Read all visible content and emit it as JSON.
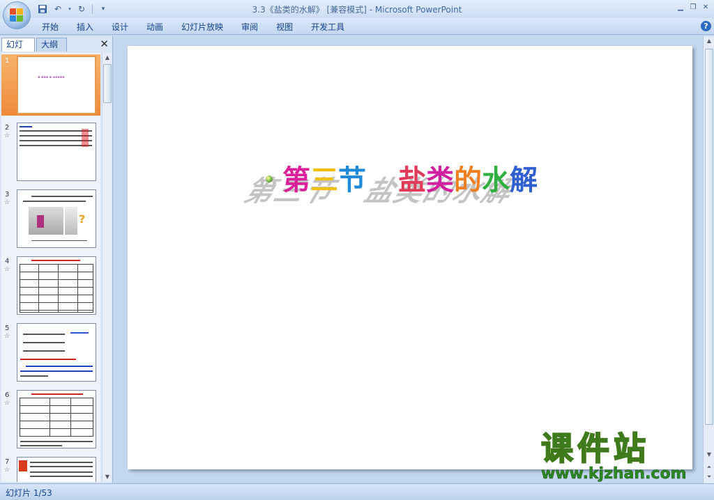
{
  "window": {
    "title_doc": "3.3《盐类的水解》 [兼容模式] -",
    "title_app": "Microsoft PowerPoint"
  },
  "ribbon": {
    "tabs": [
      "开始",
      "插入",
      "设计",
      "动画",
      "幻灯片放映",
      "审阅",
      "视图",
      "开发工具"
    ]
  },
  "panel": {
    "tab_slides": "幻灯片",
    "tab_outline": "大纲",
    "thumbnails": [
      {
        "num": "1",
        "selected": true
      },
      {
        "num": "2",
        "selected": false
      },
      {
        "num": "3",
        "selected": false
      },
      {
        "num": "4",
        "selected": false
      },
      {
        "num": "5",
        "selected": false
      },
      {
        "num": "6",
        "selected": false
      },
      {
        "num": "7",
        "selected": false
      }
    ]
  },
  "slide": {
    "title_part1": "第三节",
    "title_part2": "盐类的水解"
  },
  "status": {
    "slide_counter": "幻灯片 1/53"
  },
  "watermark": {
    "cn": "课件站",
    "url": "www.kjzhan.com"
  },
  "colors": {
    "selection": "#ee8a3b",
    "ribbon_text": "#15428b",
    "editor_bg": "#c3d7ef"
  }
}
